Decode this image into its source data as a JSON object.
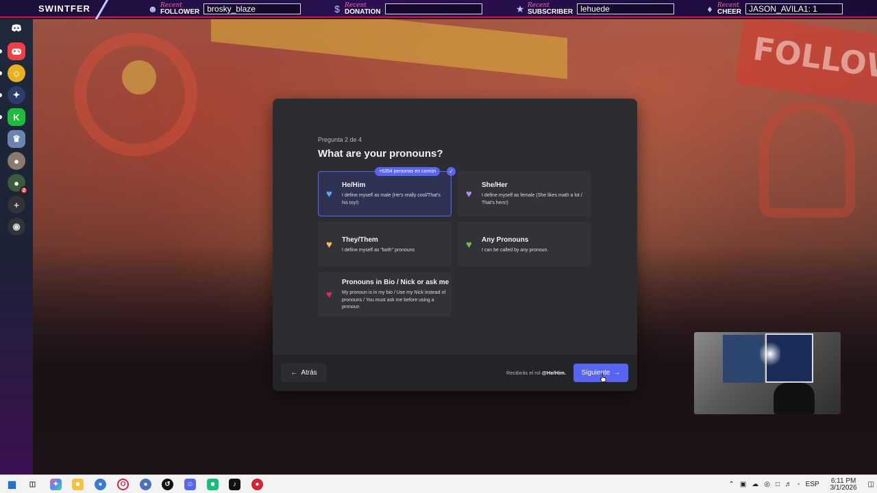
{
  "overlay": {
    "brand": "SWINTFER",
    "recent_label": "Recent",
    "items": [
      {
        "kind": "FOLLOWER",
        "value": "brosky_blaze",
        "icon": "user-plus-icon"
      },
      {
        "kind": "DONATION",
        "value": "",
        "icon": "dollar-icon"
      },
      {
        "kind": "SUBSCRIBER",
        "value": "lehuede",
        "icon": "star-icon"
      },
      {
        "kind": "CHEER",
        "value": "JASON_AVILA1: 1",
        "icon": "bits-icon"
      }
    ]
  },
  "modal": {
    "step": "Pregunta 2 de 4",
    "title": "What are your pronouns?",
    "common_badge": "+6354 personas en común",
    "options": [
      {
        "title": "He/Him",
        "desc": "I define myself as male (He's really cool/That's his toy!)",
        "heart": "blue-heart-icon",
        "color": "#5fa8f5",
        "selected": true
      },
      {
        "title": "She/Her",
        "desc": "I define myself as female (She likes math a lot / That's hers!)",
        "heart": "purple-heart-icon",
        "color": "#b48de8",
        "selected": false
      },
      {
        "title": "They/Them",
        "desc": "I define myself as \"both\" pronouns",
        "heart": "yellow-heart-icon",
        "color": "#f7c24a",
        "selected": false
      },
      {
        "title": "Any Pronouns",
        "desc": "I can be called by any pronoun.",
        "heart": "green-heart-icon",
        "color": "#6cc04a",
        "selected": false
      },
      {
        "title": "Pronouns in Bio / Nick or ask me",
        "desc": "My pronoun is in my bio / Use my Nick instead of pronouns / You must ask me before using a pronoun",
        "heart": "red-heart-icon",
        "color": "#e8294a",
        "selected": false
      }
    ],
    "back_label": "Atrás",
    "role_note_prefix": "Recibirás el rol",
    "role_name": "@He/Him.",
    "next_label": "Siguiente"
  },
  "taskbar": {
    "language": "ESP",
    "time": "6:11 PM",
    "date": "3/1/2026"
  }
}
